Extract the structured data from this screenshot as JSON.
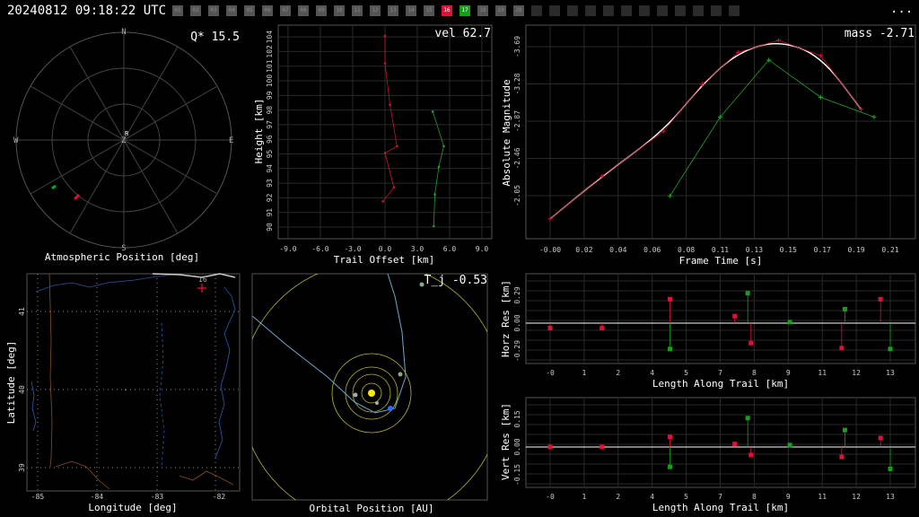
{
  "header": {
    "timestamp": "20240812 09:18:22 UTC",
    "menu_label": "...",
    "station_labels": [
      "01",
      "02",
      "03",
      "04",
      "05",
      "06",
      "07",
      "08",
      "09",
      "10",
      "11",
      "12",
      "13",
      "14",
      "15",
      "16",
      "17",
      "18",
      "19",
      "20"
    ],
    "station_count": 32,
    "highlight_red": "16",
    "highlight_green": "17"
  },
  "colors": {
    "red": "#e0103a",
    "green": "#14a018",
    "trail_red": "#c81430",
    "trail_green": "#22a22a"
  },
  "panels": {
    "atmos": {
      "label": "Atmospheric Position [deg]",
      "value_label": "Q* 15.5",
      "dirs": {
        "n": "N",
        "s": "S",
        "e": "E",
        "w": "W",
        "z": "Z",
        "r": "R"
      }
    },
    "height": {
      "label_x": "Trail Offset [km]",
      "label_y": "Height [km]",
      "value_label": "vel 62.7",
      "xticks": [
        "-9.0",
        "-6.0",
        "-3.0",
        "0.0",
        "3.0",
        "6.0",
        "9.0"
      ],
      "yticks": [
        "90",
        "91",
        "92",
        "93",
        "94",
        "95",
        "96",
        "97",
        "98",
        "99",
        "100",
        "101",
        "102",
        "104"
      ]
    },
    "mag": {
      "label_x": "Frame Time [s]",
      "label_y": "Absolute Magnitude",
      "value_label": "mass -2.71",
      "xticks": [
        "-0.00",
        "0.02",
        "0.04",
        "0.06",
        "0.08",
        "0.11",
        "0.13",
        "0.15",
        "0.17",
        "0.19",
        "0.21"
      ],
      "yticks": [
        "-3.69",
        "-3.28",
        "-2.87",
        "-2.46",
        "-2.05"
      ]
    },
    "map": {
      "label_x": "Longitude [deg]",
      "label_y": "Latitude [deg]",
      "xticks": [
        "-85",
        "-84",
        "-83",
        "-82"
      ],
      "yticks": [
        "41",
        "40",
        "39"
      ],
      "marker_label": "16"
    },
    "orbit": {
      "label": "Orbital Position [AU]",
      "value_label": "T_j -0.53"
    },
    "horz": {
      "label_x": "Length Along Trail [km]",
      "label_y": "Horz Res [km]",
      "yticks": [
        "0.29",
        "0.00",
        "-0.29"
      ]
    },
    "vert": {
      "label_x": "Length Along Trail [km]",
      "label_y": "Vert Res [km]",
      "yticks": [
        "0.15",
        "0.00",
        "-0.15"
      ]
    },
    "length_ticks": [
      "-0",
      "1",
      "2",
      "4",
      "5",
      "7",
      "8",
      "9",
      "11",
      "12",
      "13"
    ]
  },
  "chart_data": [
    {
      "type": "scatter",
      "title": "Atmospheric Position [deg]",
      "series": [
        {
          "color": "red",
          "x": [
            -0.9
          ],
          "y": [
            -0.55
          ]
        },
        {
          "color": "green",
          "x": [
            -1.2
          ],
          "y": [
            -0.5
          ]
        }
      ]
    },
    {
      "type": "line",
      "title": "vel 62.7",
      "xlabel": "Trail Offset [km]",
      "ylabel": "Height [km]",
      "xlim": [
        -10,
        10
      ],
      "series": [
        {
          "color": "red",
          "x": [
            0,
            0,
            0.5,
            1.2,
            0,
            0.9,
            -0.2
          ],
          "y": [
            104,
            102,
            99,
            96,
            95.5,
            93,
            92
          ]
        },
        {
          "color": "green",
          "x": [
            4.8,
            5.9,
            5.4,
            5,
            4.9
          ],
          "y": [
            98.5,
            96,
            94.5,
            92.5,
            90.2
          ]
        }
      ]
    },
    {
      "type": "line",
      "title": "mass -2.71",
      "xlabel": "Frame Time [s]",
      "ylabel": "Absolute Magnitude",
      "series": [
        {
          "color": "red",
          "x": [
            0,
            0.032,
            0.07,
            0.094,
            0.116,
            0.141,
            0.167,
            0.192
          ],
          "y": [
            -1.95,
            -2.34,
            -2.75,
            -3.18,
            -3.47,
            -3.58,
            -3.44,
            -2.95
          ]
        },
        {
          "color": "green",
          "x": [
            0.074,
            0.105,
            0.135,
            0.167,
            0.2
          ],
          "y": [
            -2.16,
            -2.88,
            -3.4,
            -3.06,
            -2.88
          ]
        }
      ]
    },
    {
      "type": "scatter",
      "title": "Horz Res [km]",
      "xlabel": "Length Along Trail [km]",
      "ylabel": "Horz Res [km]",
      "series": [
        {
          "color": "red",
          "x": [
            0,
            1.6,
            3.7,
            5.7,
            6.2,
            9.0,
            10.2
          ],
          "y": [
            -0.05,
            -0.05,
            0.24,
            0.07,
            -0.2,
            -0.25,
            0.24
          ]
        },
        {
          "color": "green",
          "x": [
            3.7,
            6.1,
            7.4,
            9.1,
            10.5
          ],
          "y": [
            -0.26,
            0.3,
            0.01,
            0.14,
            -0.26
          ]
        }
      ]
    },
    {
      "type": "scatter",
      "title": "Vert Res [km]",
      "xlabel": "Length Along Trail [km]",
      "ylabel": "Vert Res [km]",
      "series": [
        {
          "color": "red",
          "x": [
            0,
            1.6,
            3.7,
            5.7,
            6.2,
            9.0,
            10.2
          ],
          "y": [
            0.0,
            0.0,
            0.1,
            0.03,
            -0.08,
            -0.1,
            0.09
          ]
        },
        {
          "color": "green",
          "x": [
            3.7,
            6.1,
            7.4,
            9.1,
            10.5
          ],
          "y": [
            -0.2,
            0.29,
            0.02,
            0.17,
            -0.22
          ]
        }
      ]
    }
  ]
}
